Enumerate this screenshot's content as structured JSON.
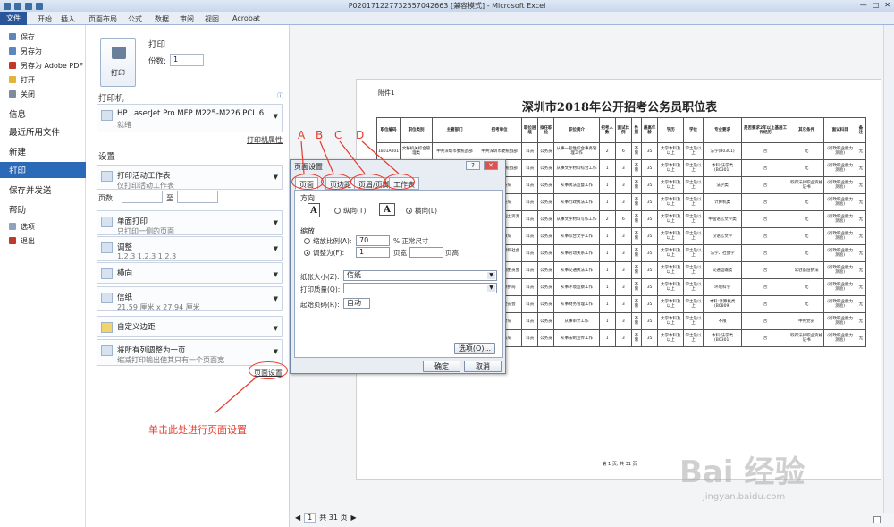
{
  "window": {
    "title": "P020171227732557042663  [兼容模式]  -  Microsoft Excel",
    "controls": [
      "—",
      "□",
      "✕"
    ]
  },
  "ribbon": {
    "file_tab": "文件",
    "tabs": [
      "开始",
      "插入",
      "页面布局",
      "公式",
      "数据",
      "审阅",
      "视图",
      "Acrobat"
    ]
  },
  "backstage": {
    "small_items": [
      "保存",
      "另存为",
      "另存为 Adobe PDF",
      "打开",
      "关闭"
    ],
    "items": [
      "信息",
      "最近所用文件",
      "新建",
      "打印",
      "保存并发送",
      "帮助"
    ],
    "active": "打印",
    "bottom_items": [
      "选项",
      "退出"
    ]
  },
  "print": {
    "section_title": "打印",
    "print_button": "打印",
    "copies_label": "份数:",
    "copies_value": "1",
    "printer_heading": "打印机",
    "printer_name": "HP LaserJet Pro MFP M225-M226 PCL 6",
    "printer_status": "就绪",
    "printer_props_link": "打印机属性",
    "settings_heading": "设置",
    "settings": [
      {
        "main": "打印活动工作表",
        "sub": "仅打印活动工作表"
      },
      {
        "main": "单面打印",
        "sub": "只打印一侧的页面"
      },
      {
        "main": "调整",
        "sub": "1,2,3    1,2,3    1,2,3"
      },
      {
        "main": "横向",
        "sub": ""
      },
      {
        "main": "信纸",
        "sub": "21.59 厘米 x 27.94 厘米"
      },
      {
        "main": "自定义边距",
        "sub": ""
      },
      {
        "main": "将所有列调整为一页",
        "sub": "缩减打印输出使其只有一个页面宽"
      }
    ],
    "pages_label": "页数:",
    "pages_to": "至",
    "page_setup_link": "页面设置"
  },
  "annotation": {
    "letters": [
      "A",
      "B",
      "C",
      "D"
    ],
    "caption": "单击此处进行页面设置"
  },
  "dialog": {
    "title": "页面设置",
    "help_btn": "?",
    "close_btn": "✕",
    "tabs": [
      "页面",
      "页边距",
      "页眉/页脚",
      "工作表"
    ],
    "direction_label": "方向",
    "portrait_icon": "A",
    "portrait": "纵向(T)",
    "landscape_icon": "A",
    "landscape": "横向(L)",
    "scale_label": "缩放",
    "scale_ratio_label": "缩放比例(A):",
    "scale_ratio_value": "70",
    "scale_ratio_suffix": "% 正常尺寸",
    "fit_label": "调整为(F):",
    "fit_wide_value": "1",
    "fit_wide_suffix": "页宽",
    "fit_tall_value": "",
    "fit_tall_suffix": "页高",
    "paper_size_label": "纸张大小(Z):",
    "paper_size_value": "信纸",
    "print_quality_label": "打印质量(Q):",
    "print_quality_value": "",
    "first_page_label": "起始页码(R):",
    "first_page_value": "自动",
    "options_btn": "选项(O)...",
    "ok_btn": "确定",
    "cancel_btn": "取消"
  },
  "sheet": {
    "attach": "附件1",
    "title": "深圳市2018年公开招考公务员职位表",
    "headers": [
      "职位编码",
      "职位类别",
      "主管部门",
      "招考单位",
      "职位层级",
      "拟任职位",
      "职位简介",
      "招考人数",
      "面试比例",
      "性别",
      "最高年龄",
      "学历",
      "学位",
      "专业要求",
      "是否要求2年以上基层工作经历",
      "其它条件",
      "面试科目",
      "备注"
    ],
    "rows": [
      [
        "1801A001",
        "文秘机关综合管理类",
        "中共深圳市委统战部",
        "中共深圳市委统战部",
        "科员",
        "公务员",
        "从事一般性综合事务管理工作",
        "2",
        "6",
        "不限",
        "35",
        "大学本科及以上",
        "学士及以上",
        "法学(B0301)",
        "否",
        "无",
        "(行政职业能力测验)",
        "无"
      ],
      [
        "1801A002",
        "文秘机关综合管理类",
        "中共深圳市委统战部",
        "中共深圳市委统战部",
        "科员",
        "公务员",
        "从事文字材料综合工作",
        "1",
        "3",
        "不限",
        "35",
        "大学本科及以上",
        "学士及以上",
        "本科:法学类(B0301)",
        "否",
        "无",
        "(行政职业能力测验)",
        "无"
      ],
      [
        "1801A003",
        "行政执法类",
        "深圳市公安局",
        "深圳市公安局",
        "科员",
        "公务员",
        "从事执法监督工作",
        "1",
        "3",
        "不限",
        "35",
        "大学本科及以上",
        "学士及以上",
        "法学类",
        "否",
        "取得法律职业资格证书",
        "(行政职业能力测验)",
        "无"
      ],
      [
        "1801A004",
        "行政执法类",
        "深圳市公安局",
        "深圳市公安局",
        "科员",
        "公务员",
        "从事行政执法工作",
        "1",
        "3",
        "不限",
        "35",
        "大学本科及以上",
        "学士及以上",
        "计算机类",
        "否",
        "无",
        "(行政职业能力测验)",
        "无"
      ],
      [
        "1801A005",
        "专业技术类",
        "深圳市规划和国土资源委员会",
        "深圳市规划和国土资源委员会",
        "科员",
        "公务员",
        "从事文字材料写作工作",
        "2",
        "6",
        "不限",
        "35",
        "大学本科及以上",
        "学士及以上",
        "中国语言文学类",
        "否",
        "无",
        "(行政职业能力测验)",
        "无"
      ],
      [
        "1801A006",
        "文秘机关综合管理类",
        "深圳市民政局",
        "深圳市民政局",
        "科员",
        "公务员",
        "从事综合文字工作",
        "1",
        "3",
        "不限",
        "35",
        "大学本科及以上",
        "学士及以上",
        "汉语言文学",
        "否",
        "无",
        "(行政职业能力测验)",
        "无"
      ],
      [
        "1801A007",
        "文秘机关综合管理类",
        "深圳市人力资源和社会保障局",
        "深圳市人力资源和社会保障局",
        "科员",
        "公务员",
        "从事劳动关系工作",
        "1",
        "3",
        "不限",
        "35",
        "大学本科及以上",
        "学士及以上",
        "法学、社会学",
        "否",
        "无",
        "(行政职业能力测验)",
        "无"
      ],
      [
        "1801A008",
        "行政执法类",
        "深圳市交通运输委员会",
        "深圳市交通运输委员会",
        "科员",
        "公务员",
        "从事交通执法工作",
        "1",
        "3",
        "不限",
        "35",
        "大学本科及以上",
        "学士及以上",
        "交通运输类",
        "否",
        "常驻基层执法",
        "(行政职业能力测验)",
        "无"
      ],
      [
        "1801A009",
        "专业技术类",
        "深圳市环境保护局",
        "深圳市环境保护局",
        "科员",
        "公务员",
        "从事环境监察工作",
        "1",
        "3",
        "不限",
        "35",
        "大学本科及以上",
        "学士及以上",
        "环境科学",
        "否",
        "无",
        "(行政职业能力测验)",
        "无"
      ],
      [
        "1801A010",
        "文秘机关综合管理类",
        "深圳市财政委员会",
        "深圳市财政委员会",
        "科员",
        "公务员",
        "从事财务管理工作",
        "1",
        "3",
        "不限",
        "35",
        "大学本科及以上",
        "学士及以上",
        "本科:计算机类(B0809)",
        "否",
        "无",
        "(行政职业能力测验)",
        "无"
      ],
      [
        "1801A011",
        "文秘机关综合管理类",
        "深圳市审计局",
        "深圳市审计局",
        "科员",
        "公务员",
        "从事审计工作",
        "1",
        "3",
        "不限",
        "35",
        "大学本科及以上",
        "学士及以上",
        "不限",
        "否",
        "中共党员",
        "(行政职业能力测验)",
        "无"
      ],
      [
        "1801A012",
        "文秘机关综合管理类",
        "深圳市司法局",
        "深圳市司法局",
        "科员",
        "公务员",
        "从事法制宣传工作",
        "1",
        "3",
        "不限",
        "35",
        "大学本科及以上",
        "学士及以上",
        "本科:法学类(B0301)",
        "否",
        "取得法律职业资格证书",
        "(行政职业能力测验)",
        "无"
      ]
    ],
    "footer": "第 1 页, 共 31 页"
  },
  "pager": {
    "current": "1",
    "total": "共 31 页"
  },
  "watermark": {
    "brand": "Bai 经验",
    "url": "jingyan.baidu.com"
  }
}
